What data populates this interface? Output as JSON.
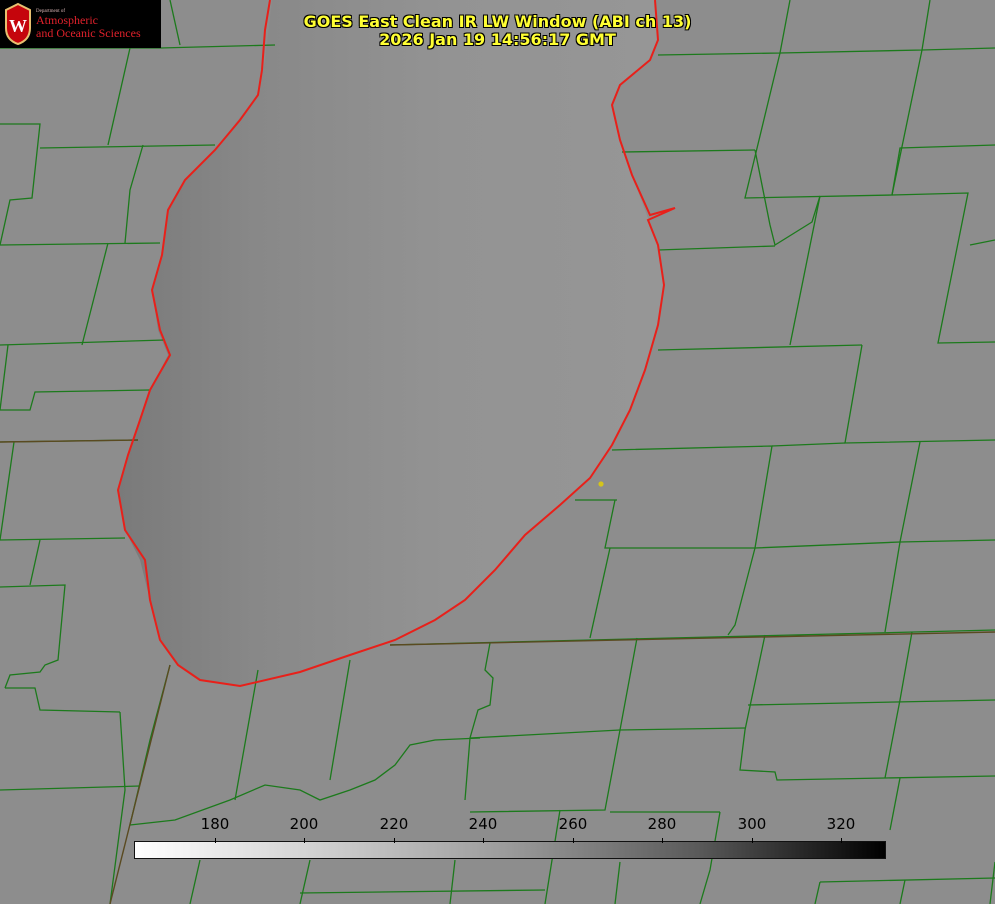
{
  "header": {
    "title": "GOES East Clean IR LW Window (ABI ch 13)",
    "timestamp": "2026 Jan 19 14:56:17 GMT"
  },
  "logo": {
    "department": "Department of",
    "line1": "Atmospheric",
    "line2": "and Oceanic Sciences",
    "crest_letter": "W"
  },
  "colorbar": {
    "ticks": [
      "180",
      "200",
      "220",
      "240",
      "260",
      "280",
      "300",
      "320"
    ],
    "gradient_low": "#ffffff",
    "gradient_high": "#000000"
  },
  "colors": {
    "county_lines": "#1c7a1c",
    "shoreline": "#e8201a",
    "title_text": "#ffff33",
    "station_marker": "#d4c41a"
  }
}
